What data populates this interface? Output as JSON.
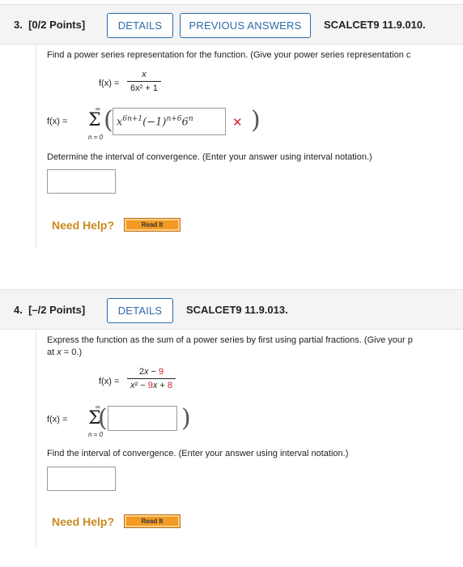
{
  "q3": {
    "number_label": "3.",
    "points_label": "[0/2 Points]",
    "details_label": "DETAILS",
    "previous_answers_label": "PREVIOUS ANSWERS",
    "code": "SCALCET9 11.9.010.",
    "prompt": "Find a power series representation for the function. (Give your power series representation c",
    "fx_label": "f(x) =",
    "numerator": "x",
    "denominator": "6x² + 1",
    "series_lhs": "f(x) =",
    "sigma_top": "∞",
    "sigma_bottom": "n = 0",
    "answer_expression": "x6n+1(−1)n+6n",
    "answer_status": "incorrect",
    "interval_prompt": "Determine the interval of convergence. (Enter your answer using interval notation.)",
    "interval_value": "",
    "need_help": "Need Help?",
    "read_it": "Read It"
  },
  "q4": {
    "number_label": "4.",
    "points_label": "[–/2 Points]",
    "details_label": "DETAILS",
    "code": "SCALCET9 11.9.013.",
    "prompt_line1": "Express the function as the sum of a power series by first using partial fractions. (Give your p",
    "prompt_line2": "at x = 0.)",
    "fx_label": "f(x) =",
    "numerator": "2x − 9",
    "denominator": "x² − 9x + 8",
    "series_lhs": "f(x) =",
    "sigma_top": "∞",
    "sigma_bottom": "n = 0",
    "answer_value": "",
    "interval_prompt": "Find the interval of convergence. (Enter your answer using interval notation.)",
    "interval_value": "",
    "need_help": "Need Help?",
    "read_it": "Read It"
  },
  "colors": {
    "accent_blue": "#2e6aa8",
    "incorrect_red": "#d3212a",
    "help_orange": "#c88a1e",
    "readit_orange": "#f29a24"
  }
}
